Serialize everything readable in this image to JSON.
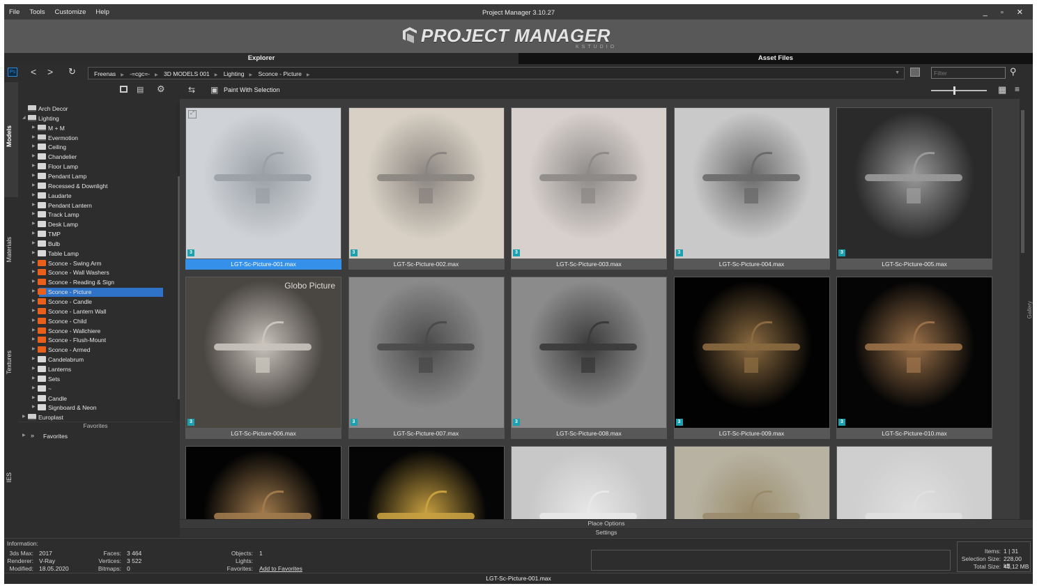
{
  "menu": [
    "File",
    "Tools",
    "Customize",
    "Help"
  ],
  "window": {
    "title": "Project Manager 3.10.27",
    "controls": "_ ▫ ✕"
  },
  "logo": {
    "text": "PROJECT MANAGER",
    "sub": "KSTUDIO"
  },
  "tabs": {
    "explorer": "Explorer",
    "asset_files": "Asset Files"
  },
  "address": {
    "ps_label": "Ps",
    "crumbs": [
      "Freenas",
      "-=cgc=-",
      "3D MODELS 001",
      "Lighting",
      "Sconce - Picture"
    ],
    "filter_placeholder": "Filter"
  },
  "vtabs": [
    "Models",
    "Materials",
    "Textures",
    "IES"
  ],
  "toolbar": {
    "paint_label": "Paint With Selection"
  },
  "tree": [
    {
      "label": "Arch Decor",
      "level": 1,
      "icon": "library",
      "arrow": ""
    },
    {
      "label": "Lighting",
      "level": 1,
      "icon": "library",
      "arrow": "open"
    },
    {
      "label": "M + M",
      "level": 2,
      "icon": "library",
      "arrow": "closed"
    },
    {
      "label": "Evermotion",
      "level": 2,
      "icon": "library",
      "arrow": "closed"
    },
    {
      "label": "Ceiling",
      "level": 2,
      "icon": "folder",
      "arrow": "closed"
    },
    {
      "label": "Chandelier",
      "level": 2,
      "icon": "folder",
      "arrow": "closed"
    },
    {
      "label": "Floor Lamp",
      "level": 2,
      "icon": "folder",
      "arrow": "closed"
    },
    {
      "label": "Pendant Lamp",
      "level": 2,
      "icon": "folder",
      "arrow": "closed"
    },
    {
      "label": "Recessed & Downlight",
      "level": 2,
      "icon": "folder",
      "arrow": "closed"
    },
    {
      "label": "Laudarte",
      "level": 2,
      "icon": "folder",
      "arrow": "closed"
    },
    {
      "label": "Pendant Lantern",
      "level": 2,
      "icon": "folder",
      "arrow": "closed"
    },
    {
      "label": "Track Lamp",
      "level": 2,
      "icon": "folder",
      "arrow": "closed"
    },
    {
      "label": "Desk Lamp",
      "level": 2,
      "icon": "folder",
      "arrow": "closed"
    },
    {
      "label": "TMP",
      "level": 2,
      "icon": "folder",
      "arrow": "closed"
    },
    {
      "label": "Bulb",
      "level": 2,
      "icon": "folder",
      "arrow": "closed"
    },
    {
      "label": "Table Lamp",
      "level": 2,
      "icon": "folder",
      "arrow": "closed"
    },
    {
      "label": "Sconce - Swing Arm",
      "level": 2,
      "icon": "orange",
      "arrow": "closed"
    },
    {
      "label": "Sconce - Wall Washers",
      "level": 2,
      "icon": "orange",
      "arrow": "closed"
    },
    {
      "label": "Sconce - Reading & Sign",
      "level": 2,
      "icon": "orange",
      "arrow": "closed"
    },
    {
      "label": "Sconce - Picture",
      "level": 2,
      "icon": "orange",
      "arrow": "closed",
      "selected": true
    },
    {
      "label": "Sconce - Candle",
      "level": 2,
      "icon": "orange",
      "arrow": "closed"
    },
    {
      "label": "Sconce - Lantern Wall",
      "level": 2,
      "icon": "orange",
      "arrow": "closed"
    },
    {
      "label": "Sconce - Child",
      "level": 2,
      "icon": "orange",
      "arrow": "closed"
    },
    {
      "label": "Sconce - Wallchiere",
      "level": 2,
      "icon": "orange",
      "arrow": "closed"
    },
    {
      "label": "Sconce - Flush-Mount",
      "level": 2,
      "icon": "orange",
      "arrow": "closed"
    },
    {
      "label": "Sconce - Armed",
      "level": 2,
      "icon": "orange",
      "arrow": "closed"
    },
    {
      "label": "Candelabrum",
      "level": 2,
      "icon": "folder",
      "arrow": "closed"
    },
    {
      "label": "Lanterns",
      "level": 2,
      "icon": "folder",
      "arrow": "closed"
    },
    {
      "label": "Sets",
      "level": 2,
      "icon": "folder",
      "arrow": "closed"
    },
    {
      "label": "~",
      "level": 2,
      "icon": "folder",
      "arrow": "closed"
    },
    {
      "label": "Candle",
      "level": 2,
      "icon": "folder",
      "arrow": "closed"
    },
    {
      "label": "Signboard & Neon",
      "level": 2,
      "icon": "folder",
      "arrow": "closed"
    },
    {
      "label": "Europlast",
      "level": 1,
      "icon": "library",
      "arrow": "closed"
    }
  ],
  "favorites": {
    "header": "Favorites",
    "item": "Favorites"
  },
  "tiles": [
    {
      "name": "LGT-Sc-Picture-001.max",
      "bg": "#cfd2d6",
      "fg": "#9aa0a6",
      "selected": true
    },
    {
      "name": "LGT-Sc-Picture-002.max",
      "bg": "#d8d0c4",
      "fg": "#8a8580"
    },
    {
      "name": "LGT-Sc-Picture-003.max",
      "bg": "#d7d0cd",
      "fg": "#8d8a88"
    },
    {
      "name": "LGT-Sc-Picture-004.max",
      "bg": "#c9c9c9",
      "fg": "#6a6a6a"
    },
    {
      "name": "LGT-Sc-Picture-005.max",
      "bg": "#2a2a2a",
      "fg": "#9a9a9a"
    },
    {
      "name": "LGT-Sc-Picture-006.max",
      "bg": "#4a4642",
      "fg": "#c9c4bc"
    },
    {
      "name": "LGT-Sc-Picture-007.max",
      "bg": "#8a8a8a",
      "fg": "#4a4a4a"
    },
    {
      "name": "LGT-Sc-Picture-008.max",
      "bg": "#8b8b8b",
      "fg": "#3a3a3a"
    },
    {
      "name": "LGT-Sc-Picture-009.max",
      "bg": "#020202",
      "fg": "#8a6a40"
    },
    {
      "name": "LGT-Sc-Picture-010.max",
      "bg": "#050505",
      "fg": "#9a7048"
    },
    {
      "name": "",
      "bg": "#030303",
      "fg": "#a07a4c"
    },
    {
      "name": "",
      "bg": "#050505",
      "fg": "#c8a040"
    },
    {
      "name": "",
      "bg": "#c8c8c8",
      "fg": "#e8e8e8"
    },
    {
      "name": "",
      "bg": "#b8b2a2",
      "fg": "#9a8c6a"
    },
    {
      "name": "",
      "bg": "#cfcfcf",
      "fg": "#e0e0e0"
    }
  ],
  "badge": "3",
  "tile_label_6": "Globo Picture",
  "place_options": "Place Options",
  "settings": "Settings",
  "info": {
    "title": "Information:",
    "max_k": "3ds Max:",
    "max_v": "2017",
    "renderer_k": "Renderer:",
    "renderer_v": "V-Ray",
    "modified_k": "Modified:",
    "modified_v": "18.05.2020",
    "faces_k": "Faces:",
    "faces_v": "3 464",
    "vertices_k": "Vertices:",
    "vertices_v": "3 522",
    "bitmaps_k": "Bitmaps:",
    "bitmaps_v": "0",
    "objects_k": "Objects:",
    "objects_v": "1",
    "lights_k": "Lights:",
    "favorites_k": "Favorites:",
    "favorites_link": "Add to Favorites",
    "items_k": "Items:",
    "items_v": "1 | 31",
    "selsize_k": "Selection Size:",
    "selsize_v": "228,00 kB",
    "total_k": "Total Size:",
    "total_v": "41,12 MB"
  },
  "status": "LGT-Sc-Picture-001.max"
}
